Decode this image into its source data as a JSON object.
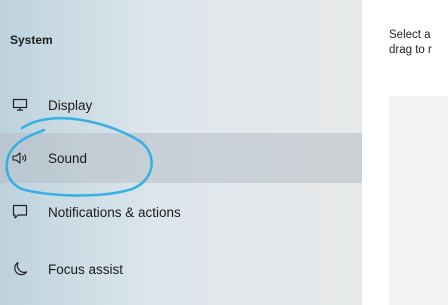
{
  "sidebar": {
    "heading": "System",
    "items": [
      {
        "label": "Display",
        "icon": "monitor-icon",
        "selected": false
      },
      {
        "label": "Sound",
        "icon": "speaker-icon",
        "selected": true
      },
      {
        "label": "Notifications & actions",
        "icon": "notification-icon",
        "selected": false
      },
      {
        "label": "Focus assist",
        "icon": "moon-icon",
        "selected": false
      }
    ]
  },
  "main": {
    "instruction_line1": "Select a",
    "instruction_line2": "drag to r"
  },
  "annotation": {
    "color": "#3ab0e2",
    "target": "Sound"
  },
  "colors": {
    "selected_row": "#b6bec4",
    "panel": "#f2f2f2"
  }
}
